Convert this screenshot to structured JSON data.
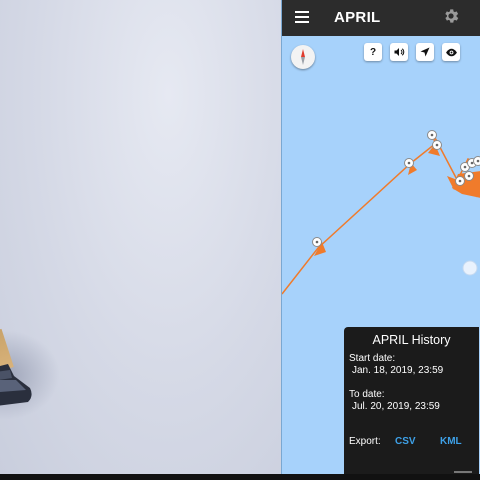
{
  "app": {
    "title": "APRIL"
  },
  "icons": {
    "menu": "menu-icon",
    "settings": "gear-icon",
    "compass": "compass-icon",
    "help": "help-icon",
    "sound": "speaker-icon",
    "location": "navigation-arrow-icon",
    "visibility": "eye-icon"
  },
  "map_buttons": {
    "help_label": "?"
  },
  "history": {
    "title": "APRIL History",
    "start_label": "Start date:",
    "start_value": "Jan. 18, 2019, 23:59",
    "to_label": "To date:",
    "to_value": "Jul. 20, 2019, 23:59",
    "export_label": "Export:",
    "csv_label": "CSV",
    "kml_label": "KML"
  },
  "colors": {
    "track": "#f07b2b",
    "map_water": "#a7d2fb",
    "appbar": "#2c2c2c",
    "link": "#3ea1e8"
  }
}
